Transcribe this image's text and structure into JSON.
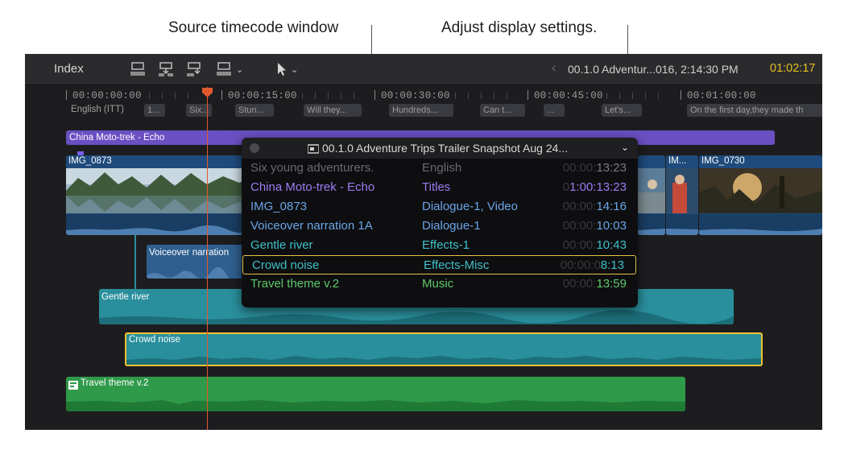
{
  "callouts": {
    "left": "Source timecode window",
    "right": "Adjust display settings."
  },
  "toolbar": {
    "index_label": "Index",
    "project_title": "00.1.0 Adventur...016, 2:14:30 PM",
    "timecode": "01:02:17",
    "icons": [
      "connect-clip-icon",
      "insert-clip-icon",
      "append-clip-icon",
      "overwrite-clip-icon",
      "select-tool-icon"
    ]
  },
  "ruler": {
    "labels": [
      "00:00:00:00",
      "00:00:15:00",
      "00:00:30:00",
      "00:00:45:00",
      "00:01:00:00"
    ],
    "caption_language": "English (ITT)",
    "captions": [
      "1...",
      "Six...",
      "Stun...",
      "Will they...",
      "Hundreds...",
      "Can t...",
      "...",
      "Let's...",
      "On the first day,they made th"
    ]
  },
  "timeline": {
    "title_clip": "China Moto-trek - Echo",
    "video_clips": [
      "IMG_0873",
      "IM...",
      "IMG_0730"
    ],
    "audio_clips": {
      "voiceover": "Voiceover narration",
      "gentle_river": "Gentle river",
      "crowd_noise": "Crowd noise",
      "travel_theme": "Travel theme v.2"
    }
  },
  "popover": {
    "title": "00.1.0 Adventure Trips Trailer Snapshot Aug 24...",
    "rows": [
      {
        "name": "Six young adventurers.",
        "role": "English",
        "tc_dim": "00:00:",
        "tc": "13:23",
        "color": "#6a6a6e",
        "tc_color": "#7a7a7e"
      },
      {
        "name": "China Moto-trek - Echo",
        "role": "Titles",
        "tc_dim": "0",
        "tc": "1:00:13:23",
        "color": "#9b7cf0",
        "tc_color": "#9b7cf0"
      },
      {
        "name": "IMG_0873",
        "role": "Dialogue-1, Video",
        "tc_dim": "00:00:",
        "tc": "14:16",
        "color": "#6aa6e8",
        "tc_color": "#6aa6e8"
      },
      {
        "name": "Voiceover narration 1A",
        "role": "Dialogue-1",
        "tc_dim": "00:00:",
        "tc": "10:03",
        "color": "#6aa6e8",
        "tc_color": "#6aa6e8"
      },
      {
        "name": "Gentle river",
        "role": "Effects-1",
        "tc_dim": "00:00:",
        "tc": "10:43",
        "color": "#3fc0c8",
        "tc_color": "#3fc0c8"
      },
      {
        "name": "Crowd noise",
        "role": "Effects-Misc",
        "tc_dim": "00:00:0",
        "tc": "8:13",
        "color": "#3fc0c8",
        "tc_color": "#3fc0c8"
      },
      {
        "name": "Travel theme v.2",
        "role": "Music",
        "tc_dim": "00:00:",
        "tc": "13:59",
        "color": "#5fc96a",
        "tc_color": "#5fc96a"
      }
    ],
    "selected_row": "Crowd noise"
  },
  "colors": {
    "accent_timecode": "#e6c020",
    "playhead": "#e2592f",
    "selection": "#f2c12e",
    "title_clip": "#6a4fc2",
    "video_clip": "#1f4b7c",
    "effects_audio": "#2a8f9c",
    "music_audio": "#2f9a4a"
  }
}
